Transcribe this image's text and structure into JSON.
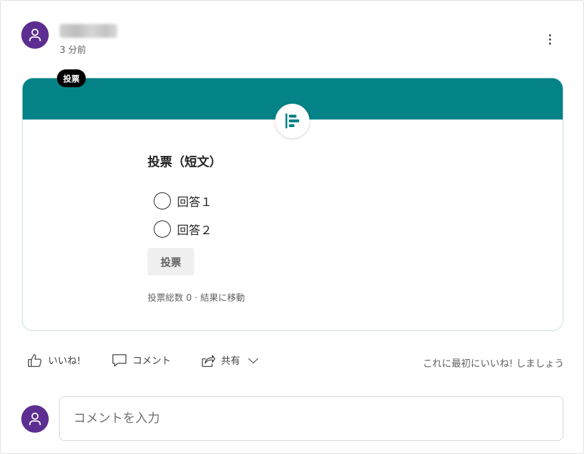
{
  "post": {
    "timestamp": "3 分前",
    "poll": {
      "badge": "投票",
      "title": "投票（短文）",
      "options": [
        {
          "label": "回答１"
        },
        {
          "label": "回答２"
        }
      ],
      "vote_button": "投票",
      "footer": {
        "total_votes": "投票総数 0",
        "separator": " · ",
        "results_link": "結果に移動"
      },
      "accent_color": "#038387"
    },
    "actions": {
      "like": "いいね!",
      "comment": "コメント",
      "share": "共有",
      "first_like_prompt": "これに最初にいいね! しましょう"
    },
    "comment_box": {
      "placeholder": "コメントを入力",
      "value": ""
    },
    "avatar_color": "#5c2e91"
  }
}
